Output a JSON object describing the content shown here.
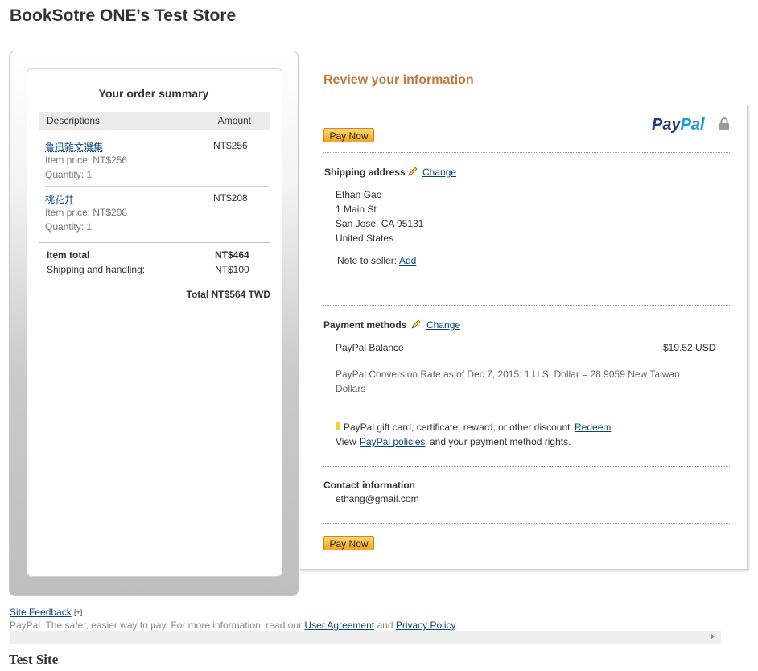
{
  "store": {
    "title": "BookSotre ONE's Test Store"
  },
  "summary": {
    "title": "Your order summary",
    "col_desc": "Descriptions",
    "col_amount": "Amount",
    "items": [
      {
        "name": "鲁迅雜文選集",
        "amount": "NT$256",
        "price": "Item price: NT$256",
        "qty": "Quantity: 1"
      },
      {
        "name": "桃花井",
        "amount": "NT$208",
        "price": "Item price: NT$208",
        "qty": "Quantity: 1"
      }
    ],
    "item_total_label": "Item total",
    "item_total_value": "NT$464",
    "shipping_label": "Shipping and handling:",
    "shipping_value": "NT$100",
    "grand_total": "Total NT$564 TWD"
  },
  "review": {
    "title": "Review your information",
    "logo_pay": "Pay",
    "logo_pal": "Pal",
    "pay_now_label": "Pay Now",
    "shipping": {
      "label": "Shipping address",
      "change": "Change",
      "name": "Ethan Gao",
      "street": "1 Main St",
      "city": "San Jose, CA 95131",
      "country": "United States",
      "note_label": "Note to seller:",
      "note_link": "Add"
    },
    "payment": {
      "label": "Payment methods",
      "change": "Change",
      "method": "PayPal Balance",
      "amount": "$19.52 USD",
      "conversion_line1": "PayPal Conversion Rate as of Dec 7, 2015: 1 U.S. Dollar = 28.9059 New Taiwan",
      "conversion_line2": "Dollars",
      "gift_text": "PayPal gift card, certificate, reward, or other discount",
      "gift_link": "Redeem",
      "policy_prefix": "View",
      "policy_link": "PayPal policies",
      "policy_suffix": "and your payment method rights."
    },
    "contact": {
      "label": "Contact information",
      "email": "ethang@gmail.com"
    }
  },
  "footer": {
    "feedback": "Site Feedback",
    "feedback_plus": "[+]",
    "text_prefix": "PayPal. The safer, easier way to pay. For more information, read our",
    "user_agreement": "User Agreement",
    "and": "and",
    "privacy": "Privacy Policy",
    "period": ".",
    "test_site": "Test Site"
  },
  "colors": {
    "accent_orange": "#c07a3c",
    "link_blue": "#084482",
    "paypal_dark": "#253b80",
    "paypal_light": "#179bd7",
    "button_orange": "#f7a41c"
  }
}
